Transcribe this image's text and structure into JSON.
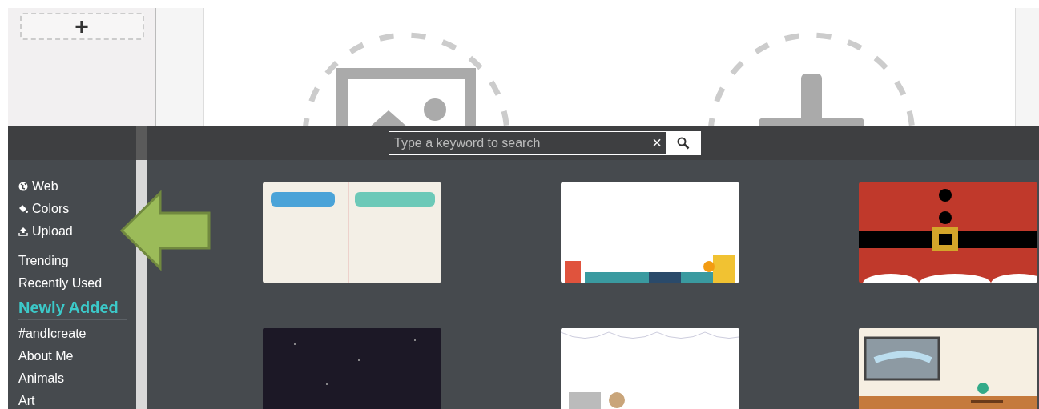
{
  "editor": {
    "add_button": {
      "label": "+"
    }
  },
  "picker": {
    "search": {
      "placeholder": "Type a keyword to search",
      "clear": "×"
    },
    "sidebar": {
      "groups": [
        {
          "kind": "tools",
          "items": [
            {
              "label": "Web",
              "selected": false
            },
            {
              "label": "Colors",
              "selected": false
            },
            {
              "label": "Upload",
              "selected": false
            }
          ]
        },
        {
          "items": [
            {
              "label": "Trending",
              "selected": false
            },
            {
              "label": "Recently Used",
              "selected": false
            },
            {
              "label": "Newly Added",
              "selected": true
            }
          ]
        },
        {
          "items": [
            {
              "label": "#andIcreate",
              "selected": false
            },
            {
              "label": "About Me",
              "selected": false
            },
            {
              "label": "Animals",
              "selected": false
            },
            {
              "label": "Art",
              "selected": false
            }
          ]
        }
      ]
    }
  }
}
